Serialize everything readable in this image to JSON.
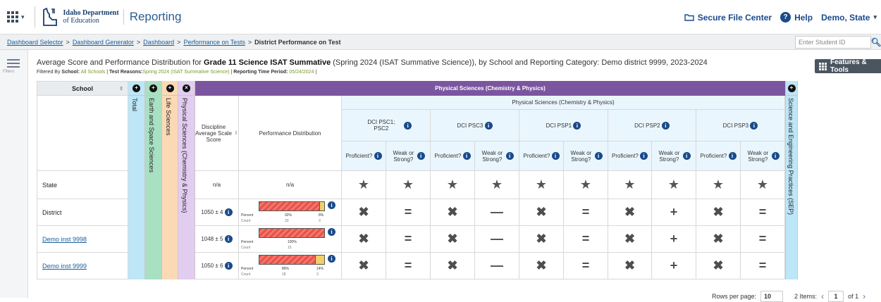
{
  "topbar": {
    "logo_line1": "Idaho Department",
    "logo_line2": "of Education",
    "app_title": "Reporting",
    "secure_file_center": "Secure File Center",
    "help": "Help",
    "user": "Demo, State"
  },
  "breadcrumb": {
    "items": [
      "Dashboard Selector",
      "Dashboard Generator",
      "Dashboard",
      "Performance on Tests"
    ],
    "current": "District Performance on Test",
    "separator": ">"
  },
  "student_search": {
    "placeholder": "Enter Student ID"
  },
  "left_rail": {
    "label": "Filters"
  },
  "report": {
    "title_pre": "Average Score and Performance Distribution for ",
    "title_bold": "Grade 11 Science ISAT Summative",
    "title_post": " (Spring 2024 (ISAT Summative Science)), by School and Reporting Category: Demo district 9999, 2023-2024",
    "filter_label": "Filtered By",
    "school_label": "School:",
    "school_value": "All Schools",
    "reasons_label": "Test Reasons:",
    "reasons_value": "Spring 2024 (ISAT Summative Science)",
    "period_label": "Reporting Time Period:",
    "period_value": "05/24/2024",
    "pipe": "|"
  },
  "features_button": "Features & Tools",
  "table": {
    "school_header": "School",
    "collapsed_columns": [
      {
        "label": "Total",
        "color": "#bde6f7"
      },
      {
        "label": "Earth and Space Sciences",
        "color": "#a8e0c2"
      },
      {
        "label": "Life Sciences",
        "color": "#fcd9b5"
      },
      {
        "label": "Physical Sciences (Chemistry & Physics)",
        "color": "#e2cdf0"
      }
    ],
    "group_header": "Physical Sciences (Chemistry & Physics)",
    "subgroup_header": "Physical Sciences (Chemistry & Physics)",
    "discipline_header": "Discipline Average Scale Score",
    "perf_header": "Performance Distribution",
    "dci": [
      "DCI PSC1; PSC2",
      "DCI PSC3",
      "DCI PSP1",
      "DCI PSP2",
      "DCI PSP3"
    ],
    "proficient": "Proficient?",
    "weak_strong": "Weak or Strong?",
    "sep_header": "Science and Engineering Practices (SEP)",
    "bar_labels": {
      "percent": "Percent",
      "count": "Count"
    },
    "rows": [
      {
        "name": "State",
        "link": false,
        "score": "n/a",
        "perf_text": "n/a",
        "cells": [
          "★",
          "★",
          "★",
          "★",
          "★",
          "★",
          "★",
          "★",
          "★",
          "★"
        ]
      },
      {
        "name": "District",
        "link": false,
        "score": "1050 ± 4",
        "perf": {
          "red_pct": 92,
          "yellow_pct": 8,
          "red_label": "92%",
          "yellow_label": "8%",
          "red_count": "33",
          "yellow_count": "3"
        },
        "cells": [
          "✖",
          "=",
          "✖",
          "—",
          "✖",
          "=",
          "✖",
          "+",
          "✖",
          "="
        ]
      },
      {
        "name": "Demo inst 9998",
        "link": true,
        "score": "1048 ± 5",
        "perf": {
          "red_pct": 100,
          "yellow_pct": 0,
          "red_label": "100%",
          "yellow_label": "",
          "red_count": "15",
          "yellow_count": ""
        },
        "cells": [
          "✖",
          "=",
          "✖",
          "—",
          "✖",
          "=",
          "✖",
          "+",
          "✖",
          "="
        ]
      },
      {
        "name": "Demo inst 9999",
        "link": true,
        "score": "1050 ± 6",
        "perf": {
          "red_pct": 86,
          "yellow_pct": 14,
          "red_label": "86%",
          "yellow_label": "14%",
          "red_count": "18",
          "yellow_count": "3"
        },
        "cells": [
          "✖",
          "=",
          "✖",
          "—",
          "✖",
          "=",
          "✖",
          "+",
          "✖",
          "="
        ]
      }
    ]
  },
  "footer": {
    "rows_per_page_label": "Rows per page:",
    "rows_per_page": "10",
    "items": "2 Items:",
    "page": "1",
    "of": "of 1"
  }
}
